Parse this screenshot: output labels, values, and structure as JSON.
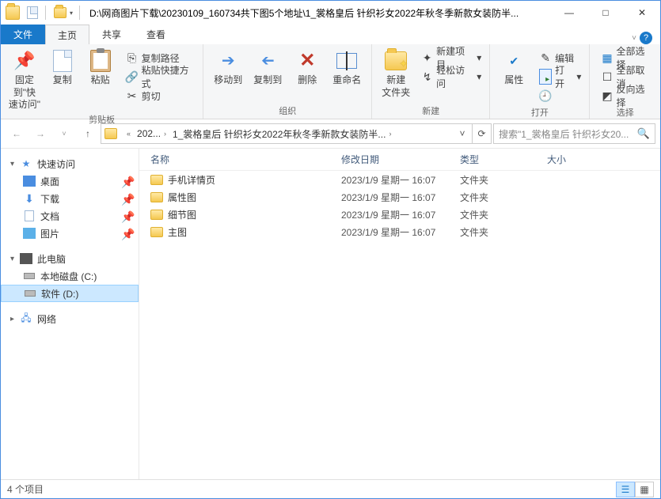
{
  "title_path": "D:\\网商图片下载\\20230109_160734共下图5个地址\\1_裳格皇后 针织衫女2022年秋冬季新款女装防半...",
  "ribbon_tabs": {
    "file": "文件",
    "home": "主页",
    "share": "共享",
    "view": "查看"
  },
  "ribbon": {
    "pin": "固定到\"快\n速访问\"",
    "copy": "复制",
    "paste": "粘贴",
    "copy_path": "复制路径",
    "paste_shortcut": "粘贴快捷方式",
    "cut": "剪切",
    "clipboard_group": "剪贴板",
    "move_to": "移动到",
    "copy_to": "复制到",
    "delete": "删除",
    "rename": "重命名",
    "organize_group": "组织",
    "new_folder": "新建\n文件夹",
    "new_item": "新建项目",
    "easy_access": "轻松访问",
    "new_group": "新建",
    "properties": "属性",
    "edit": "编辑",
    "open_menu": "打开",
    "history": "历史记录",
    "open_group": "打开",
    "select_all": "全部选择",
    "select_none": "全部取消",
    "invert_sel": "反向选择",
    "select_group": "选择"
  },
  "breadcrumb": {
    "seg1": "202...",
    "seg2": "1_裳格皇后 针织衫女2022年秋冬季新款女装防半..."
  },
  "search_placeholder": "搜索\"1_裳格皇后 针织衫女20...",
  "sidebar": {
    "quick_access": "快速访问",
    "desktop": "桌面",
    "downloads": "下载",
    "documents": "文档",
    "pictures": "图片",
    "this_pc": "此电脑",
    "drive_c": "本地磁盘 (C:)",
    "drive_d": "软件 (D:)",
    "network": "网络"
  },
  "columns": {
    "name": "名称",
    "date": "修改日期",
    "type": "类型",
    "size": "大小"
  },
  "rows": [
    {
      "name": "手机详情页",
      "date": "2023/1/9 星期一 16:07",
      "type": "文件夹"
    },
    {
      "name": "属性图",
      "date": "2023/1/9 星期一 16:07",
      "type": "文件夹"
    },
    {
      "name": "细节图",
      "date": "2023/1/9 星期一 16:07",
      "type": "文件夹"
    },
    {
      "name": "主图",
      "date": "2023/1/9 星期一 16:07",
      "type": "文件夹"
    }
  ],
  "status": "4 个项目"
}
